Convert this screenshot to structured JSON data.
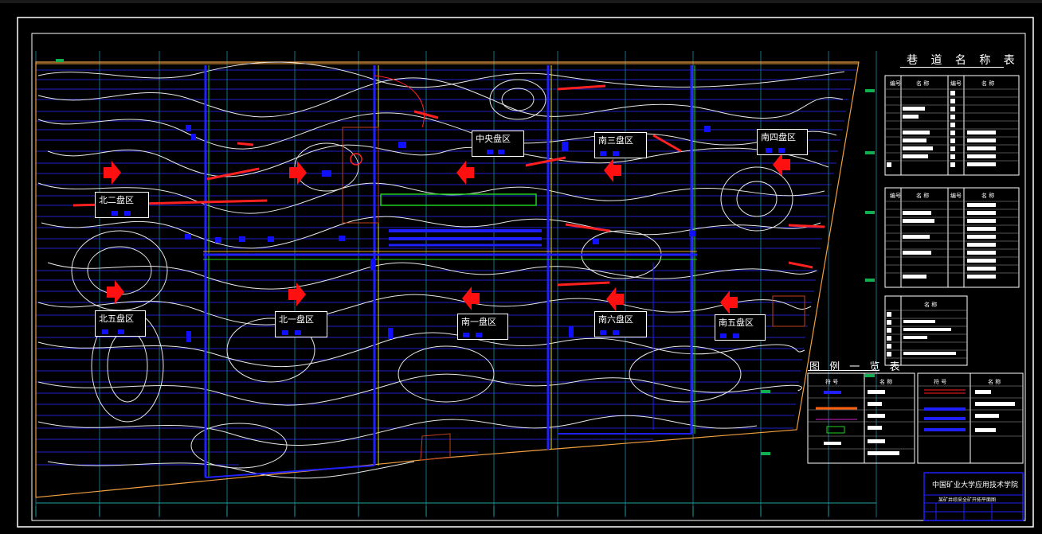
{
  "drawing": {
    "zones": [
      {
        "id": "n2",
        "label": "北二盘区"
      },
      {
        "id": "c1",
        "label": "中央盘区"
      },
      {
        "id": "s3",
        "label": "南三盘区"
      },
      {
        "id": "s4",
        "label": "南四盘区"
      },
      {
        "id": "n5",
        "label": "北五盘区"
      },
      {
        "id": "n1",
        "label": "北一盘区"
      },
      {
        "id": "s1",
        "label": "南一盘区"
      },
      {
        "id": "s6",
        "label": "南六盘区"
      },
      {
        "id": "s5",
        "label": "南五盘区"
      }
    ],
    "roadway_table_title": "巷 道 名 称 表",
    "roadway_table_headers": [
      "编号",
      "名 称",
      "编号",
      "名 称"
    ],
    "legend_title": "图 例 一 览 表",
    "legend_headers": [
      "符 号",
      "名 称",
      "符 号",
      "名 称"
    ],
    "small_table_header": "名 称",
    "school_name": "中国矿业大学应用技术学院",
    "drawing_name": "某矿井综采全矿开拓平面图"
  }
}
